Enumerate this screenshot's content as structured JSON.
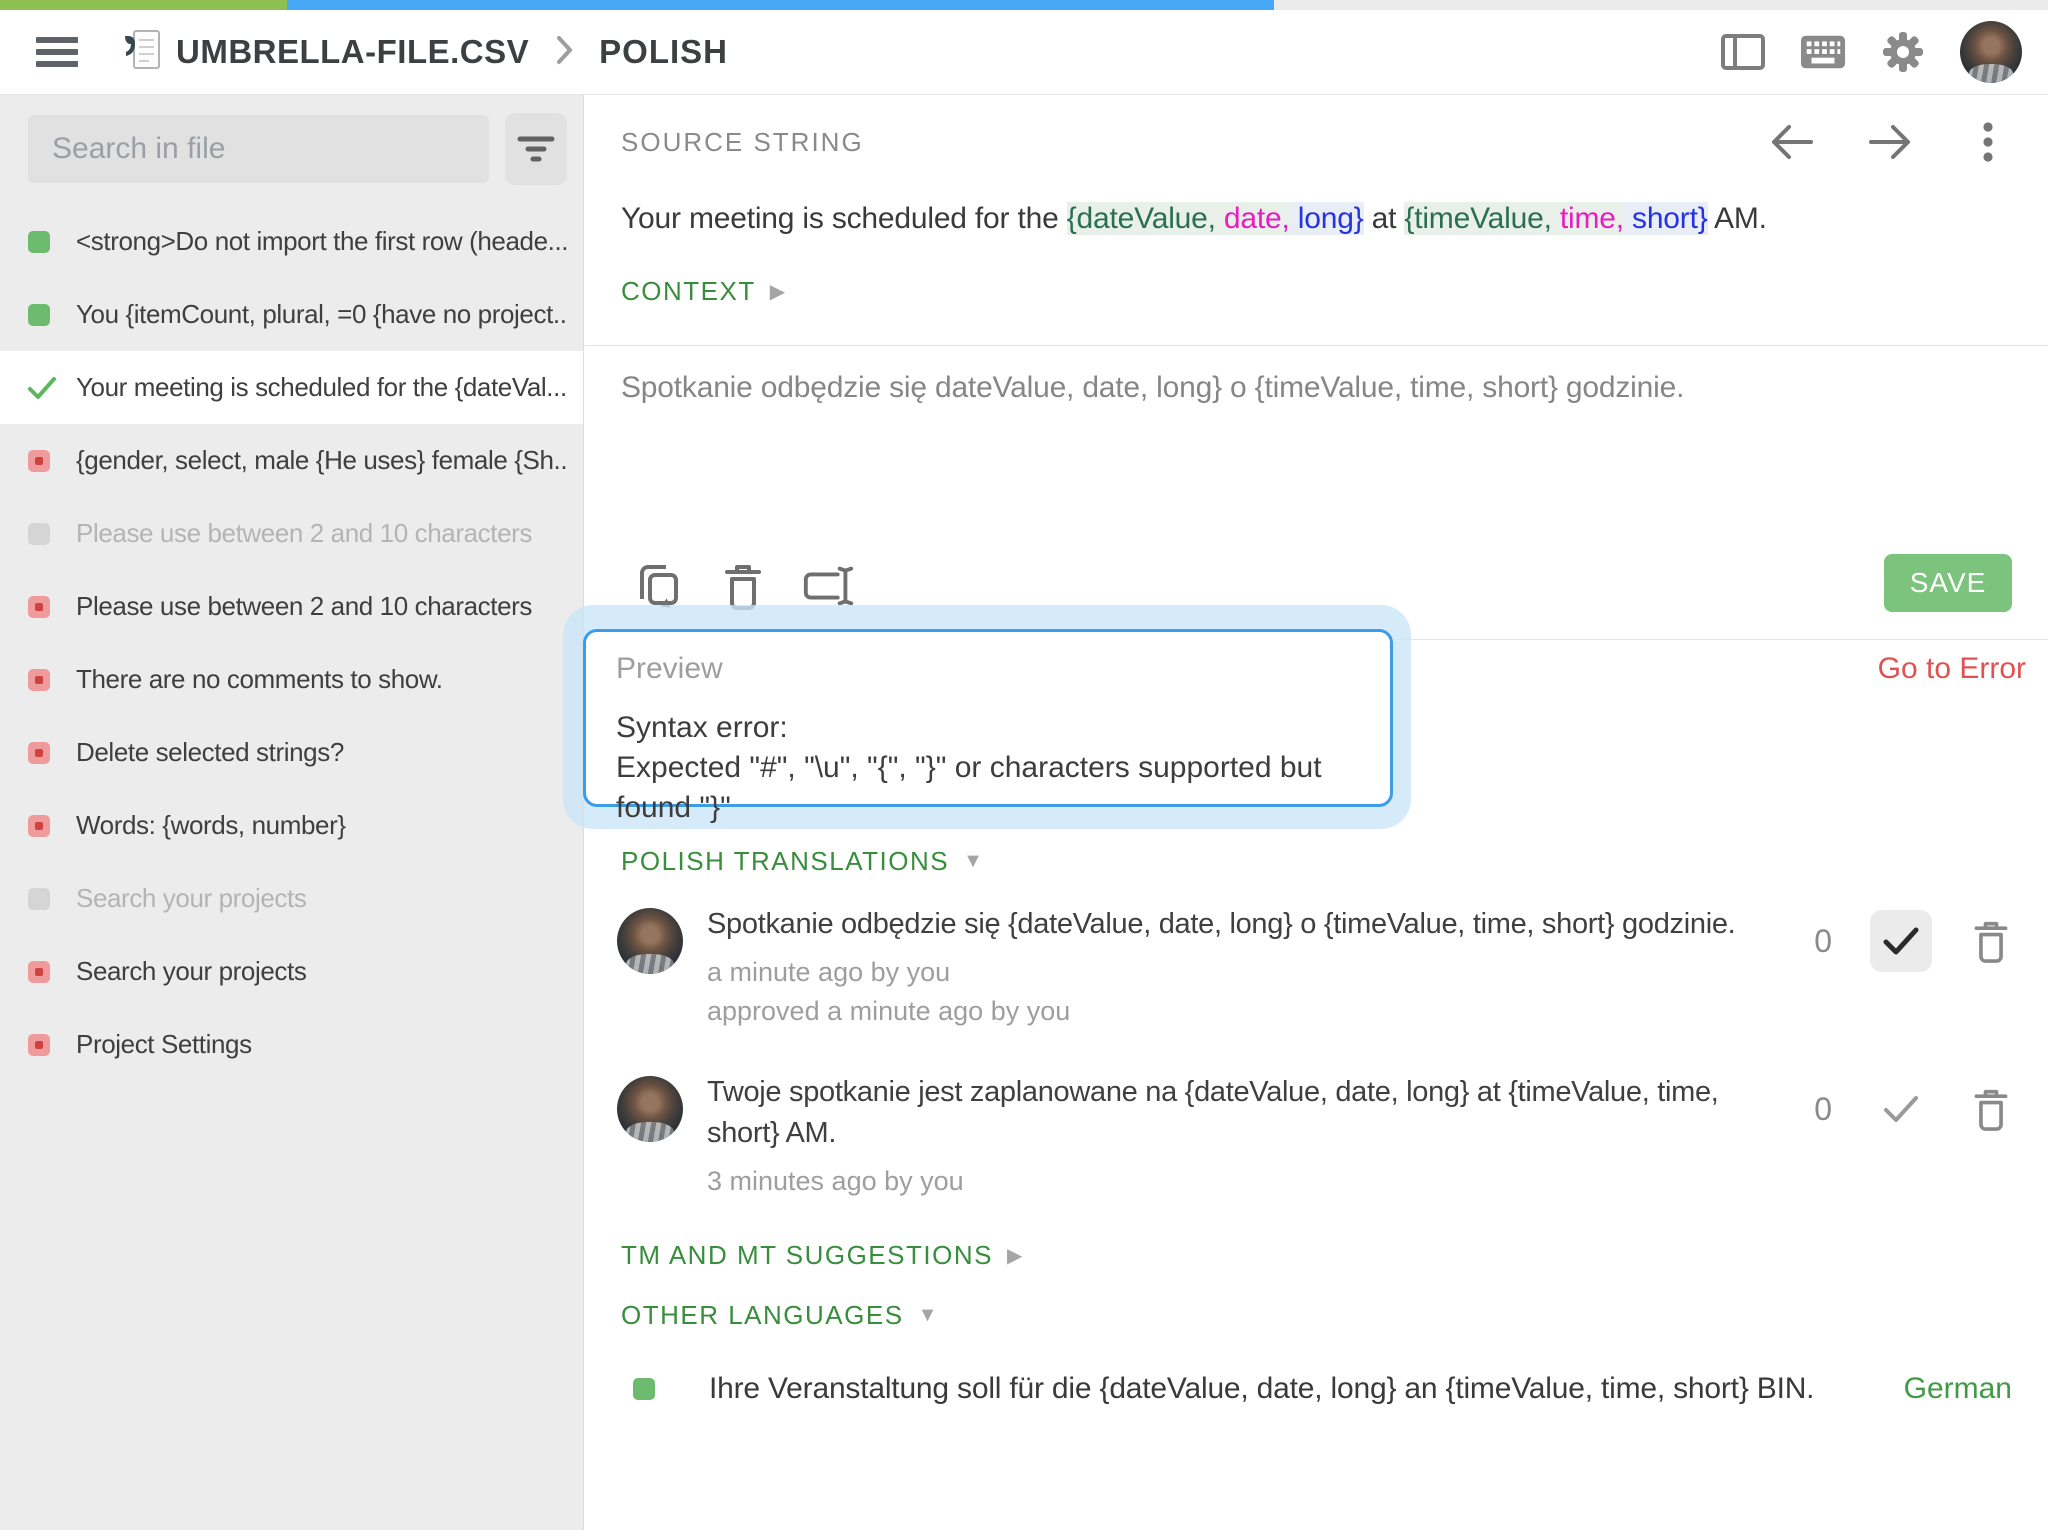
{
  "colors": {
    "accent_green": "#388e3c",
    "save_green": "#7cc47e",
    "error_red": "#e05252",
    "token_variable": "#2a7050",
    "token_type": "#e51dc2",
    "token_format": "#2533e0",
    "highlight_green": "#e9f0ea",
    "highlight_blue": "#e8edf6",
    "popup_border_blue": "#3c9ce8"
  },
  "progress": {
    "segments": [
      {
        "name": "approved",
        "color": "#8cc152",
        "pct": 14
      },
      {
        "name": "translated",
        "color": "#47a6f5",
        "pct": 48.2
      },
      {
        "name": "remaining",
        "color": "#ebebeb",
        "pct": 37.8
      }
    ]
  },
  "header": {
    "breadcrumb_file": "UMBRELLA-FILE.CSV",
    "breadcrumb_language": "POLISH"
  },
  "sidebar": {
    "search_placeholder": "Search in file",
    "items": [
      {
        "status": "translated",
        "label": "<strong>Do not import the first row (heade...",
        "selected": false,
        "muted": false
      },
      {
        "status": "translated",
        "label": "You {itemCount, plural, =0 {have no project...",
        "selected": false,
        "muted": false
      },
      {
        "status": "approved",
        "label": "Your meeting is scheduled for the {dateVal...",
        "selected": true,
        "muted": false
      },
      {
        "status": "error",
        "label": "{gender, select, male {He uses} female {Sh...",
        "selected": false,
        "muted": false
      },
      {
        "status": "untranslated",
        "label": "Please use between 2 and 10 characters",
        "selected": false,
        "muted": true
      },
      {
        "status": "error",
        "label": "Please use between 2 and 10 characters",
        "selected": false,
        "muted": false
      },
      {
        "status": "error",
        "label": "There are no comments to show.",
        "selected": false,
        "muted": false
      },
      {
        "status": "error",
        "label": "Delete selected strings?",
        "selected": false,
        "muted": false
      },
      {
        "status": "error",
        "label": "Words: {words, number}",
        "selected": false,
        "muted": false
      },
      {
        "status": "untranslated",
        "label": "Search your projects",
        "selected": false,
        "muted": true
      },
      {
        "status": "error",
        "label": "Search your projects",
        "selected": false,
        "muted": false
      },
      {
        "status": "error",
        "label": "Project Settings",
        "selected": false,
        "muted": false
      }
    ]
  },
  "main": {
    "source_label": "SOURCE STRING",
    "source_segments": [
      {
        "text": "Your meeting is scheduled for the ",
        "kind": "plain"
      },
      {
        "text": "{dateValue,",
        "kind": "var"
      },
      {
        "text": " date,",
        "kind": "type"
      },
      {
        "text": " long}",
        "kind": "fmt"
      },
      {
        "text": " at ",
        "kind": "plain"
      },
      {
        "text": "{timeValue,",
        "kind": "var"
      },
      {
        "text": " time,",
        "kind": "type"
      },
      {
        "text": " short}",
        "kind": "fmt"
      },
      {
        "text": " AM.",
        "kind": "plain"
      }
    ],
    "context_label": "CONTEXT",
    "translation_draft": "Spotkanie odbędzie się dateValue, date, long} o {timeValue, time, short} godzinie.",
    "save_label": "SAVE",
    "go_to_error": "Go to Error",
    "preview": {
      "title": "Preview",
      "line1": "Syntax error:",
      "line2": "Expected \"#\", \"\\u\", \"{\", \"}\" or characters supported but found \"}\""
    },
    "translations_header": "POLISH TRANSLATIONS",
    "translations": [
      {
        "text": "Spotkanie odbędzie się {dateValue, date, long} o {timeValue, time, short} godzinie.",
        "meta1": "a minute ago by you",
        "meta2": "approved a minute ago by you",
        "votes": "0",
        "approved": true
      },
      {
        "text": "Twoje spotkanie jest zaplanowane na {dateValue, date, long} at {timeValue, time, short} AM.",
        "meta1": "3 minutes ago by you",
        "meta2": "",
        "votes": "0",
        "approved": false
      }
    ],
    "tm_header": "TM AND MT SUGGESTIONS",
    "other_languages_header": "OTHER LANGUAGES",
    "other_languages": [
      {
        "text": "Ihre Veranstaltung soll für die {dateValue, date, long} an {timeValue, time, short} BIN.",
        "language": "German"
      }
    ]
  }
}
